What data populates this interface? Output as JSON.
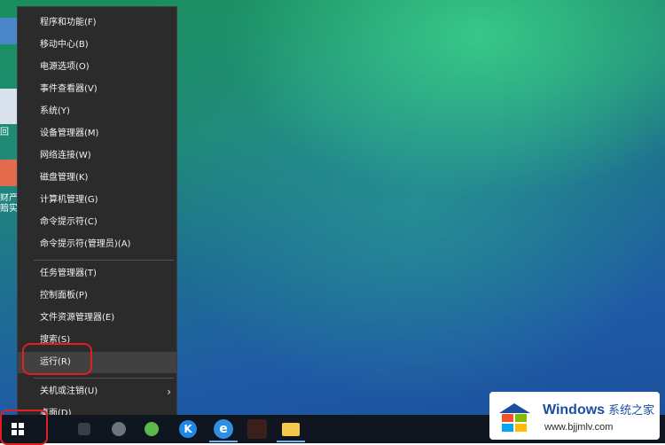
{
  "desktop": {
    "left_icon_labels": [
      "回",
      "财产\n赔实"
    ]
  },
  "context_menu": {
    "groups": [
      [
        {
          "label": "程序和功能(F)"
        },
        {
          "label": "移动中心(B)"
        },
        {
          "label": "电源选项(O)"
        },
        {
          "label": "事件查看器(V)"
        },
        {
          "label": "系统(Y)"
        },
        {
          "label": "设备管理器(M)"
        },
        {
          "label": "网络连接(W)"
        },
        {
          "label": "磁盘管理(K)"
        },
        {
          "label": "计算机管理(G)"
        },
        {
          "label": "命令提示符(C)"
        },
        {
          "label": "命令提示符(管理员)(A)"
        }
      ],
      [
        {
          "label": "任务管理器(T)"
        },
        {
          "label": "控制面板(P)"
        },
        {
          "label": "文件资源管理器(E)"
        },
        {
          "label": "搜索(S)"
        },
        {
          "label": "运行(R)",
          "highlighted": true
        }
      ],
      [
        {
          "label": "关机或注销(U)",
          "submenu_icon": "chevron-right-icon"
        },
        {
          "label": "桌面(D)"
        }
      ]
    ]
  },
  "taskbar": {
    "items": [
      {
        "icon": "windows-start-icon"
      },
      {
        "icon": "task-view-icon"
      },
      {
        "icon": "app-icon"
      },
      {
        "icon": "green-app-icon"
      },
      {
        "icon": "k-app-icon",
        "glyph": "K"
      },
      {
        "icon": "ie-browser-icon",
        "glyph": "e"
      },
      {
        "icon": "image-app-icon"
      },
      {
        "icon": "file-explorer-icon"
      }
    ]
  },
  "watermark": {
    "title": "Windows",
    "title_cn": "系统之家",
    "url": "www.bjjmlv.com",
    "logo_colors": [
      "#f35325",
      "#81bc06",
      "#05a6f0",
      "#ffba08"
    ]
  },
  "annotation_color": "#e01f1f"
}
